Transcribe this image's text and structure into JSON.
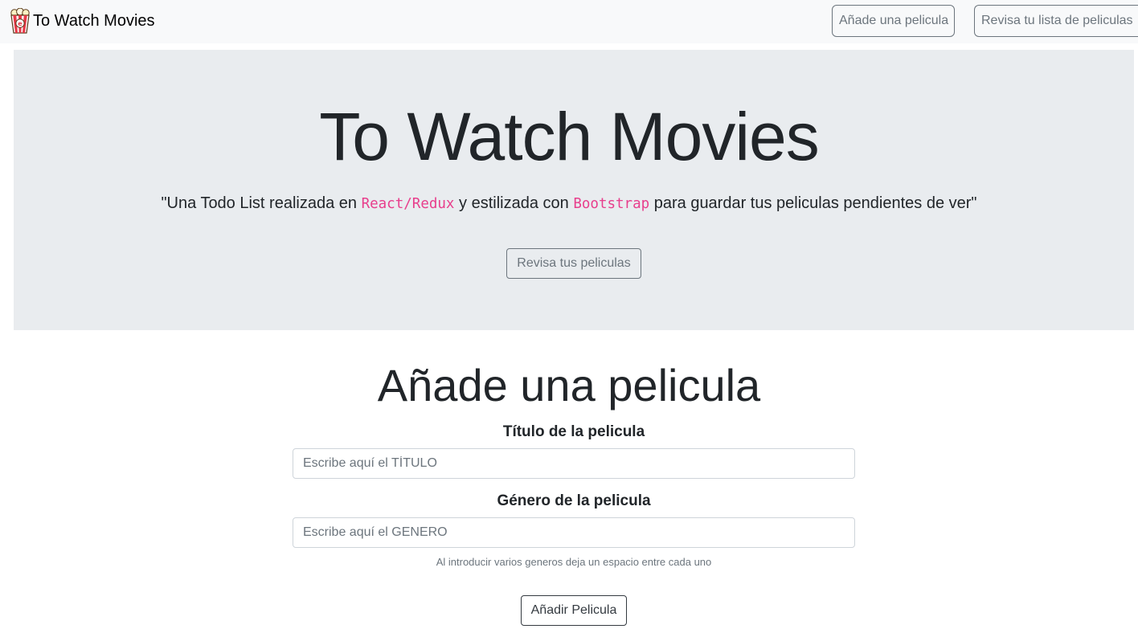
{
  "navbar": {
    "brand_icon": "popcorn-icon",
    "brand": "To Watch Movies",
    "add_link": "Añade una pelicula",
    "list_link": "Revisa tu lista de peliculas"
  },
  "hero": {
    "title": "To Watch Movies",
    "lead_before": "\"Una Todo List realizada en ",
    "lead_code1": "React/Redux",
    "lead_middle": " y estilizada con ",
    "lead_code2": "Bootstrap",
    "lead_after": " para guardar tus peliculas pendientes de ver\"",
    "button": "Revisa tus peliculas"
  },
  "form": {
    "title": "Añade una pelicula",
    "title_label": "Título de la pelicula",
    "title_placeholder": "Escribe aquí el TÍTULO",
    "genre_label": "Género de la pelicula",
    "genre_placeholder": "Escribe aquí el GENERO",
    "help": "Al introducir varios generos deja un espacio entre cada uno",
    "submit": "Añadir Pelicula"
  },
  "colors": {
    "navbar_bg": "#f8f9fa",
    "jumbotron_bg": "#e9ecef",
    "code_pink": "#e83e8c",
    "secondary": "#6c757d",
    "dark": "#343a40"
  }
}
